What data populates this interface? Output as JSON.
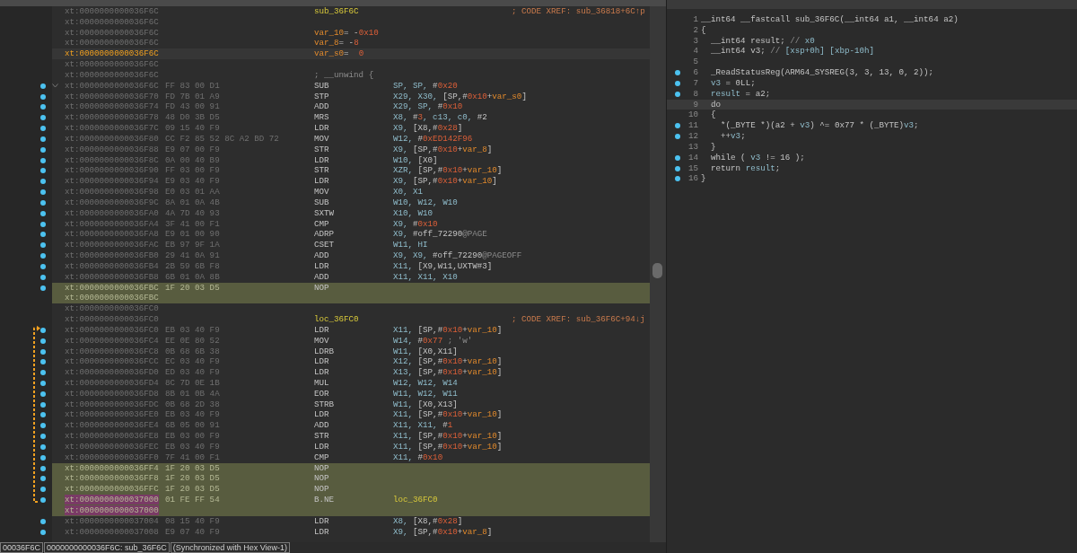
{
  "disassembly": {
    "rows": [
      {
        "kind": "label",
        "address": "xt:0000000000036F6C",
        "label": "sub_36F6C",
        "comment": "; CODE XREF: sub_36818+6C↑p",
        "dot": false,
        "selected": false,
        "patched": false
      },
      {
        "kind": "blank",
        "address": "xt:0000000000036F6C",
        "dot": false,
        "selected": false,
        "patched": false
      },
      {
        "kind": "decl",
        "address": "xt:0000000000036F6C",
        "operands": [
          {
            "text": "var_10",
            "kind": "v"
          },
          {
            "text": "= -",
            "kind": "p"
          },
          {
            "text": "0x10",
            "kind": "n"
          }
        ],
        "dot": false,
        "selected": false,
        "patched": false
      },
      {
        "kind": "decl",
        "address": "xt:0000000000036F6C",
        "operands": [
          {
            "text": "var_8",
            "kind": "v"
          },
          {
            "text": "= -",
            "kind": "p"
          },
          {
            "text": "8",
            "kind": "n"
          }
        ],
        "dot": false,
        "selected": false,
        "patched": false
      },
      {
        "kind": "decl",
        "address": "xt:0000000000036F6C",
        "operands": [
          {
            "text": "var_s0",
            "kind": "v"
          },
          {
            "text": "=  ",
            "kind": "p"
          },
          {
            "text": "0",
            "kind": "n"
          }
        ],
        "dot": false,
        "selected": true,
        "patched": false
      },
      {
        "kind": "blank",
        "address": "xt:0000000000036F6C",
        "dot": false,
        "selected": false,
        "patched": false
      },
      {
        "kind": "decl",
        "address": "xt:0000000000036F6C",
        "operands": [
          {
            "text": "; __unwind {",
            "kind": "c"
          }
        ],
        "dot": false,
        "selected": false,
        "patched": false
      },
      {
        "kind": "insn",
        "address": "xt:0000000000036F6C",
        "bytes": "FF 83 00 D1",
        "mnemonic": "SUB",
        "operands": [
          {
            "text": "SP, SP, ",
            "kind": "r"
          },
          {
            "text": "#",
            "kind": "p"
          },
          {
            "text": "0x20",
            "kind": "n"
          }
        ],
        "dot": true,
        "collapsible": true,
        "selected": false,
        "patched": false
      },
      {
        "kind": "insn",
        "address": "xt:0000000000036F70",
        "bytes": "FD 7B 01 A9",
        "mnemonic": "STP",
        "operands": [
          {
            "text": "X29, X30, ",
            "kind": "r"
          },
          {
            "text": "[SP,#",
            "kind": "p"
          },
          {
            "text": "0x10",
            "kind": "n"
          },
          {
            "text": "+",
            "kind": "p"
          },
          {
            "text": "var_s0",
            "kind": "v"
          },
          {
            "text": "]",
            "kind": "p"
          }
        ],
        "dot": true,
        "selected": false,
        "patched": false
      },
      {
        "kind": "insn",
        "address": "xt:0000000000036F74",
        "bytes": "FD 43 00 91",
        "mnemonic": "ADD",
        "operands": [
          {
            "text": "X29, SP, ",
            "kind": "r"
          },
          {
            "text": "#",
            "kind": "p"
          },
          {
            "text": "0x10",
            "kind": "n"
          }
        ],
        "dot": true,
        "selected": false,
        "patched": false
      },
      {
        "kind": "insn",
        "address": "xt:0000000000036F78",
        "bytes": "48 D0 3B D5",
        "mnemonic": "MRS",
        "operands": [
          {
            "text": "X8, ",
            "kind": "r"
          },
          {
            "text": "#",
            "kind": "p"
          },
          {
            "text": "3",
            "kind": "n"
          },
          {
            "text": ", c13, c0, ",
            "kind": "r"
          },
          {
            "text": "#2",
            "kind": "p"
          }
        ],
        "dot": true,
        "selected": false,
        "patched": false
      },
      {
        "kind": "insn",
        "address": "xt:0000000000036F7C",
        "bytes": "09 15 40 F9",
        "mnemonic": "LDR",
        "operands": [
          {
            "text": "X9, ",
            "kind": "r"
          },
          {
            "text": "[X8,#",
            "kind": "p"
          },
          {
            "text": "0x28",
            "kind": "n"
          },
          {
            "text": "]",
            "kind": "p"
          }
        ],
        "dot": true,
        "selected": false,
        "patched": false
      },
      {
        "kind": "insn",
        "address": "xt:0000000000036F80",
        "bytes": "CC F2 85 52 8C A2 BD 72",
        "mnemonic": "MOV",
        "operands": [
          {
            "text": "W12, ",
            "kind": "r"
          },
          {
            "text": "#",
            "kind": "p"
          },
          {
            "text": "0xED142F96",
            "kind": "n"
          }
        ],
        "dot": true,
        "selected": false,
        "patched": false
      },
      {
        "kind": "insn",
        "address": "xt:0000000000036F88",
        "bytes": "E9 07 00 F9",
        "mnemonic": "STR",
        "operands": [
          {
            "text": "X9, ",
            "kind": "r"
          },
          {
            "text": "[SP,#",
            "kind": "p"
          },
          {
            "text": "0x10",
            "kind": "n"
          },
          {
            "text": "+",
            "kind": "p"
          },
          {
            "text": "var_8",
            "kind": "v"
          },
          {
            "text": "]",
            "kind": "p"
          }
        ],
        "dot": true,
        "selected": false,
        "patched": false
      },
      {
        "kind": "insn",
        "address": "xt:0000000000036F8C",
        "bytes": "0A 00 40 B9",
        "mnemonic": "LDR",
        "operands": [
          {
            "text": "W10, ",
            "kind": "r"
          },
          {
            "text": "[X0]",
            "kind": "p"
          }
        ],
        "dot": true,
        "selected": false,
        "patched": false
      },
      {
        "kind": "insn",
        "address": "xt:0000000000036F90",
        "bytes": "FF 03 00 F9",
        "mnemonic": "STR",
        "operands": [
          {
            "text": "XZR, ",
            "kind": "r"
          },
          {
            "text": "[SP,#",
            "kind": "p"
          },
          {
            "text": "0x10",
            "kind": "n"
          },
          {
            "text": "+",
            "kind": "p"
          },
          {
            "text": "var_10",
            "kind": "v"
          },
          {
            "text": "]",
            "kind": "p"
          }
        ],
        "dot": true,
        "selected": false,
        "patched": false
      },
      {
        "kind": "insn",
        "address": "xt:0000000000036F94",
        "bytes": "E9 03 40 F9",
        "mnemonic": "LDR",
        "operands": [
          {
            "text": "X9, ",
            "kind": "r"
          },
          {
            "text": "[SP,#",
            "kind": "p"
          },
          {
            "text": "0x10",
            "kind": "n"
          },
          {
            "text": "+",
            "kind": "p"
          },
          {
            "text": "var_10",
            "kind": "v"
          },
          {
            "text": "]",
            "kind": "p"
          }
        ],
        "dot": true,
        "selected": false,
        "patched": false
      },
      {
        "kind": "insn",
        "address": "xt:0000000000036F98",
        "bytes": "E0 03 01 AA",
        "mnemonic": "MOV",
        "operands": [
          {
            "text": "X0, X1",
            "kind": "r"
          }
        ],
        "dot": true,
        "selected": false,
        "patched": false
      },
      {
        "kind": "insn",
        "address": "xt:0000000000036F9C",
        "bytes": "8A 01 0A 4B",
        "mnemonic": "SUB",
        "operands": [
          {
            "text": "W10, W12, W10",
            "kind": "r"
          }
        ],
        "dot": true,
        "selected": false,
        "patched": false
      },
      {
        "kind": "insn",
        "address": "xt:0000000000036FA0",
        "bytes": "4A 7D 40 93",
        "mnemonic": "SXTW",
        "operands": [
          {
            "text": "X10, W10",
            "kind": "r"
          }
        ],
        "dot": true,
        "selected": false,
        "patched": false
      },
      {
        "kind": "insn",
        "address": "xt:0000000000036FA4",
        "bytes": "3F 41 00 F1",
        "mnemonic": "CMP",
        "operands": [
          {
            "text": "X9, ",
            "kind": "r"
          },
          {
            "text": "#",
            "kind": "p"
          },
          {
            "text": "0x10",
            "kind": "n"
          }
        ],
        "dot": true,
        "selected": false,
        "patched": false
      },
      {
        "kind": "insn",
        "address": "xt:0000000000036FA8",
        "bytes": "E9 01 00 90",
        "mnemonic": "ADRP",
        "operands": [
          {
            "text": "X9, ",
            "kind": "r"
          },
          {
            "text": "#off_72290",
            "kind": "p"
          },
          {
            "text": "@PAGE",
            "kind": "c"
          }
        ],
        "dot": true,
        "selected": false,
        "patched": false
      },
      {
        "kind": "insn",
        "address": "xt:0000000000036FAC",
        "bytes": "EB 97 9F 1A",
        "mnemonic": "CSET",
        "operands": [
          {
            "text": "W11, HI",
            "kind": "r"
          }
        ],
        "dot": true,
        "selected": false,
        "patched": false
      },
      {
        "kind": "insn",
        "address": "xt:0000000000036FB0",
        "bytes": "29 41 0A 91",
        "mnemonic": "ADD",
        "operands": [
          {
            "text": "X9, X9, ",
            "kind": "r"
          },
          {
            "text": "#off_72290",
            "kind": "p"
          },
          {
            "text": "@PAGEOFF",
            "kind": "c"
          }
        ],
        "dot": true,
        "selected": false,
        "patched": false
      },
      {
        "kind": "insn",
        "address": "xt:0000000000036FB4",
        "bytes": "2B 59 6B F8",
        "mnemonic": "LDR",
        "operands": [
          {
            "text": "X11, ",
            "kind": "r"
          },
          {
            "text": "[X9,W11,UXTW#3]",
            "kind": "p"
          }
        ],
        "dot": true,
        "selected": false,
        "patched": false
      },
      {
        "kind": "insn",
        "address": "xt:0000000000036FB8",
        "bytes": "6B 01 0A 8B",
        "mnemonic": "ADD",
        "operands": [
          {
            "text": "X11, X11, X10",
            "kind": "r"
          }
        ],
        "dot": true,
        "selected": false,
        "patched": false
      },
      {
        "kind": "insn",
        "address": "xt:0000000000036FBC",
        "bytes": "1F 20 03 D5",
        "mnemonic": "NOP",
        "dot": true,
        "selected": false,
        "patched": true
      },
      {
        "kind": "blank",
        "address": "xt:0000000000036FBC",
        "dot": false,
        "selected": false,
        "patched": true
      },
      {
        "kind": "blank",
        "address": "xt:0000000000036FC0",
        "dot": false,
        "selected": false,
        "patched": false
      },
      {
        "kind": "label",
        "address": "xt:0000000000036FC0",
        "label": "loc_36FC0",
        "comment": "; CODE XREF: sub_36F6C+94↓j",
        "dot": false,
        "selected": false,
        "patched": false
      },
      {
        "kind": "insn",
        "address": "xt:0000000000036FC0",
        "bytes": "EB 03 40 F9",
        "mnemonic": "LDR",
        "operands": [
          {
            "text": "X11, ",
            "kind": "r"
          },
          {
            "text": "[SP,#",
            "kind": "p"
          },
          {
            "text": "0x10",
            "kind": "n"
          },
          {
            "text": "+",
            "kind": "p"
          },
          {
            "text": "var_10",
            "kind": "v"
          },
          {
            "text": "]",
            "kind": "p"
          }
        ],
        "dot": true,
        "selected": false,
        "patched": false
      },
      {
        "kind": "insn",
        "address": "xt:0000000000036FC4",
        "bytes": "EE 0E 80 52",
        "mnemonic": "MOV",
        "operands": [
          {
            "text": "W14, ",
            "kind": "r"
          },
          {
            "text": "#",
            "kind": "p"
          },
          {
            "text": "0x77",
            "kind": "n"
          },
          {
            "text": " ; 'w'",
            "kind": "c"
          }
        ],
        "dot": true,
        "selected": false,
        "patched": false
      },
      {
        "kind": "insn",
        "address": "xt:0000000000036FC8",
        "bytes": "0B 68 6B 38",
        "mnemonic": "LDRB",
        "operands": [
          {
            "text": "W11, ",
            "kind": "r"
          },
          {
            "text": "[X0,X11]",
            "kind": "p"
          }
        ],
        "dot": true,
        "selected": false,
        "patched": false
      },
      {
        "kind": "insn",
        "address": "xt:0000000000036FCC",
        "bytes": "EC 03 40 F9",
        "mnemonic": "LDR",
        "operands": [
          {
            "text": "X12, ",
            "kind": "r"
          },
          {
            "text": "[SP,#",
            "kind": "p"
          },
          {
            "text": "0x10",
            "kind": "n"
          },
          {
            "text": "+",
            "kind": "p"
          },
          {
            "text": "var_10",
            "kind": "v"
          },
          {
            "text": "]",
            "kind": "p"
          }
        ],
        "dot": true,
        "selected": false,
        "patched": false
      },
      {
        "kind": "insn",
        "address": "xt:0000000000036FD0",
        "bytes": "ED 03 40 F9",
        "mnemonic": "LDR",
        "operands": [
          {
            "text": "X13, ",
            "kind": "r"
          },
          {
            "text": "[SP,#",
            "kind": "p"
          },
          {
            "text": "0x10",
            "kind": "n"
          },
          {
            "text": "+",
            "kind": "p"
          },
          {
            "text": "var_10",
            "kind": "v"
          },
          {
            "text": "]",
            "kind": "p"
          }
        ],
        "dot": true,
        "selected": false,
        "patched": false
      },
      {
        "kind": "insn",
        "address": "xt:0000000000036FD4",
        "bytes": "8C 7D 0E 1B",
        "mnemonic": "MUL",
        "operands": [
          {
            "text": "W12, W12, W14",
            "kind": "r"
          }
        ],
        "dot": true,
        "selected": false,
        "patched": false
      },
      {
        "kind": "insn",
        "address": "xt:0000000000036FD8",
        "bytes": "8B 01 0B 4A",
        "mnemonic": "EOR",
        "operands": [
          {
            "text": "W11, W12, W11",
            "kind": "r"
          }
        ],
        "dot": true,
        "selected": false,
        "patched": false
      },
      {
        "kind": "insn",
        "address": "xt:0000000000036FDC",
        "bytes": "0B 68 2D 38",
        "mnemonic": "STRB",
        "operands": [
          {
            "text": "W11, ",
            "kind": "r"
          },
          {
            "text": "[X0,X13]",
            "kind": "p"
          }
        ],
        "dot": true,
        "selected": false,
        "patched": false
      },
      {
        "kind": "insn",
        "address": "xt:0000000000036FE0",
        "bytes": "EB 03 40 F9",
        "mnemonic": "LDR",
        "operands": [
          {
            "text": "X11, ",
            "kind": "r"
          },
          {
            "text": "[SP,#",
            "kind": "p"
          },
          {
            "text": "0x10",
            "kind": "n"
          },
          {
            "text": "+",
            "kind": "p"
          },
          {
            "text": "var_10",
            "kind": "v"
          },
          {
            "text": "]",
            "kind": "p"
          }
        ],
        "dot": true,
        "selected": false,
        "patched": false
      },
      {
        "kind": "insn",
        "address": "xt:0000000000036FE4",
        "bytes": "6B 05 00 91",
        "mnemonic": "ADD",
        "operands": [
          {
            "text": "X11, X11, ",
            "kind": "r"
          },
          {
            "text": "#",
            "kind": "p"
          },
          {
            "text": "1",
            "kind": "n"
          }
        ],
        "dot": true,
        "selected": false,
        "patched": false
      },
      {
        "kind": "insn",
        "address": "xt:0000000000036FE8",
        "bytes": "EB 03 00 F9",
        "mnemonic": "STR",
        "operands": [
          {
            "text": "X11, ",
            "kind": "r"
          },
          {
            "text": "[SP,#",
            "kind": "p"
          },
          {
            "text": "0x10",
            "kind": "n"
          },
          {
            "text": "+",
            "kind": "p"
          },
          {
            "text": "var_10",
            "kind": "v"
          },
          {
            "text": "]",
            "kind": "p"
          }
        ],
        "dot": true,
        "selected": false,
        "patched": false
      },
      {
        "kind": "insn",
        "address": "xt:0000000000036FEC",
        "bytes": "EB 03 40 F9",
        "mnemonic": "LDR",
        "operands": [
          {
            "text": "X11, ",
            "kind": "r"
          },
          {
            "text": "[SP,#",
            "kind": "p"
          },
          {
            "text": "0x10",
            "kind": "n"
          },
          {
            "text": "+",
            "kind": "p"
          },
          {
            "text": "var_10",
            "kind": "v"
          },
          {
            "text": "]",
            "kind": "p"
          }
        ],
        "dot": true,
        "selected": false,
        "patched": false
      },
      {
        "kind": "insn",
        "address": "xt:0000000000036FF0",
        "bytes": "7F 41 00 F1",
        "mnemonic": "CMP",
        "operands": [
          {
            "text": "X11, ",
            "kind": "r"
          },
          {
            "text": "#",
            "kind": "p"
          },
          {
            "text": "0x10",
            "kind": "n"
          }
        ],
        "dot": true,
        "selected": false,
        "patched": false
      },
      {
        "kind": "insn",
        "address": "xt:0000000000036FF4",
        "bytes": "1F 20 03 D5",
        "mnemonic": "NOP",
        "dot": true,
        "selected": false,
        "patched": true
      },
      {
        "kind": "insn",
        "address": "xt:0000000000036FF8",
        "bytes": "1F 20 03 D5",
        "mnemonic": "NOP",
        "dot": true,
        "selected": false,
        "patched": true
      },
      {
        "kind": "insn",
        "address": "xt:0000000000036FFC",
        "bytes": "1F 20 03 D5",
        "mnemonic": "NOP",
        "dot": true,
        "selected": false,
        "patched": true
      },
      {
        "kind": "insn",
        "address": "xt:0000000000037000",
        "bytes": "01 FE FF 54",
        "mnemonic": "B.NE",
        "operands": [
          {
            "text": "loc_36FC0",
            "kind": "l"
          }
        ],
        "dot": true,
        "selected": false,
        "patched": true,
        "address_marked": true
      },
      {
        "kind": "blank",
        "address": "xt:0000000000037000",
        "dot": false,
        "selected": false,
        "patched": true,
        "address_marked": true
      },
      {
        "kind": "insn",
        "address": "xt:0000000000037004",
        "bytes": "08 15 40 F9",
        "mnemonic": "LDR",
        "operands": [
          {
            "text": "X8, ",
            "kind": "r"
          },
          {
            "text": "[X8,#",
            "kind": "p"
          },
          {
            "text": "0x28",
            "kind": "n"
          },
          {
            "text": "]",
            "kind": "p"
          }
        ],
        "dot": true,
        "selected": false,
        "patched": false
      },
      {
        "kind": "insn",
        "address": "xt:0000000000037008",
        "bytes": "E9 07 40 F9",
        "mnemonic": "LDR",
        "operands": [
          {
            "text": "X9, ",
            "kind": "r"
          },
          {
            "text": "[SP,#",
            "kind": "p"
          },
          {
            "text": "0x10",
            "kind": "n"
          },
          {
            "text": "+",
            "kind": "p"
          },
          {
            "text": "var_8",
            "kind": "v"
          },
          {
            "text": "]",
            "kind": "p"
          }
        ],
        "dot": true,
        "selected": false,
        "patched": false
      }
    ]
  },
  "status_bar": [
    "00036F6C",
    "0000000000036F6C: sub_36F6C",
    "(Synchronized with Hex View-1)"
  ],
  "pseudocode": {
    "lines": [
      {
        "number": "1",
        "dot": false,
        "selected": false,
        "tokens": [
          {
            "text": "__int64 __fastcall sub_36F6C(__int64 a1, __int64 a2)",
            "kind": "p"
          }
        ]
      },
      {
        "number": "2",
        "dot": false,
        "selected": false,
        "tokens": [
          {
            "text": "{",
            "kind": "p"
          }
        ]
      },
      {
        "number": "3",
        "dot": false,
        "selected": false,
        "tokens": [
          {
            "text": "  __int64 result; ",
            "kind": "p"
          },
          {
            "text": "// ",
            "kind": "c"
          },
          {
            "text": "x0",
            "kind": "r"
          }
        ]
      },
      {
        "number": "4",
        "dot": false,
        "selected": false,
        "tokens": [
          {
            "text": "  __int64 v3; ",
            "kind": "p"
          },
          {
            "text": "// ",
            "kind": "c"
          },
          {
            "text": "[xsp+0h] [xbp-10h]",
            "kind": "r"
          }
        ]
      },
      {
        "number": "5",
        "dot": false,
        "selected": false
      },
      {
        "number": "6",
        "dot": true,
        "selected": false,
        "tokens": [
          {
            "text": "  _ReadStatusReg(ARM64_SYSREG(3, 3, 13, 0, 2));",
            "kind": "p"
          }
        ]
      },
      {
        "number": "7",
        "dot": true,
        "selected": false,
        "tokens": [
          {
            "text": "  v3",
            "kind": "r"
          },
          {
            "text": " = 0LL;",
            "kind": "p"
          }
        ]
      },
      {
        "number": "8",
        "dot": true,
        "selected": false,
        "tokens": [
          {
            "text": "  result",
            "kind": "r"
          },
          {
            "text": " = a2;",
            "kind": "p"
          }
        ]
      },
      {
        "number": "9",
        "dot": false,
        "selected": true,
        "tokens": [
          {
            "text": "  do",
            "kind": "p"
          }
        ]
      },
      {
        "number": "10",
        "dot": false,
        "selected": false,
        "tokens": [
          {
            "text": "  {",
            "kind": "p"
          }
        ]
      },
      {
        "number": "11",
        "dot": true,
        "selected": false,
        "tokens": [
          {
            "text": "    *(_BYTE *)(a2 + ",
            "kind": "p"
          },
          {
            "text": "v3",
            "kind": "r"
          },
          {
            "text": ") ^= 0x77 * (_BYTE)",
            "kind": "p"
          },
          {
            "text": "v3",
            "kind": "r"
          },
          {
            "text": ";",
            "kind": "p"
          }
        ]
      },
      {
        "number": "12",
        "dot": true,
        "selected": false,
        "tokens": [
          {
            "text": "    ++",
            "kind": "p"
          },
          {
            "text": "v3",
            "kind": "r"
          },
          {
            "text": ";",
            "kind": "p"
          }
        ]
      },
      {
        "number": "13",
        "dot": false,
        "selected": false,
        "tokens": [
          {
            "text": "  }",
            "kind": "p"
          }
        ]
      },
      {
        "number": "14",
        "dot": true,
        "selected": false,
        "tokens": [
          {
            "text": "  while ( ",
            "kind": "p"
          },
          {
            "text": "v3",
            "kind": "r"
          },
          {
            "text": " != 16 );",
            "kind": "p"
          }
        ]
      },
      {
        "number": "15",
        "dot": true,
        "selected": false,
        "tokens": [
          {
            "text": "  return ",
            "kind": "p"
          },
          {
            "text": "result",
            "kind": "r"
          },
          {
            "text": ";",
            "kind": "p"
          }
        ]
      },
      {
        "number": "16",
        "dot": true,
        "selected": false,
        "tokens": [
          {
            "text": "}",
            "kind": "p"
          }
        ]
      }
    ]
  }
}
